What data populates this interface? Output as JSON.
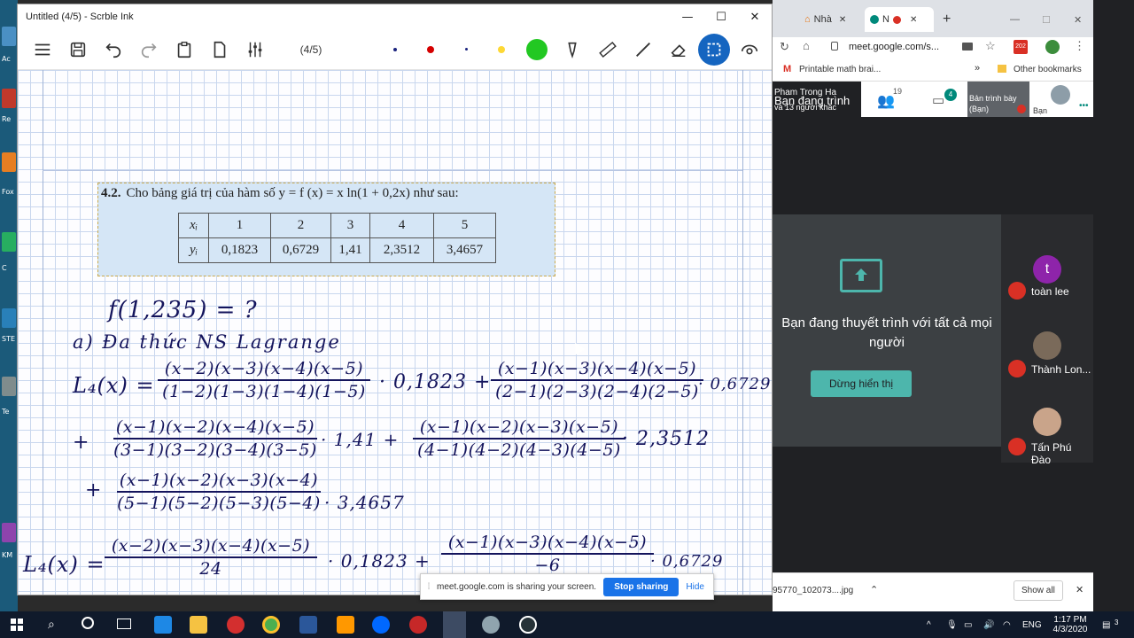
{
  "scrble": {
    "title": "Untitled (4/5) - Scrble Ink",
    "page_indicator": "(4/5)",
    "minimize_glyph": "—",
    "maximize_glyph": "☐",
    "close_glyph": "✕",
    "toolbar_icons": [
      "menu-icon",
      "save-icon",
      "undo-icon",
      "redo-icon",
      "paste-icon",
      "page-icon",
      "sliders-icon"
    ],
    "pen_colors": [
      "#1a237e",
      "#d50000",
      "#1a237e",
      "#fdd835",
      "#22c822"
    ]
  },
  "problem": {
    "number": "4.2.",
    "statement": "Cho bảng giá trị của hàm số  y = f (x) = x ln(1 + 0,2x)  như sau:",
    "row_x_label": "xᵢ",
    "row_y_label": "yᵢ",
    "x_values": [
      "1",
      "2",
      "3",
      "4",
      "5"
    ],
    "y_values": [
      "0,1823",
      "0,6729",
      "1,41",
      "2,3512",
      "3,4657"
    ]
  },
  "handwriting": {
    "question": "f(1,235) = ?",
    "part_a": "a)  Đa  thức  NS  Lagrange",
    "l4_label": "L₄(x) =",
    "t1_num": "(x−2)(x−3)(x−4)(x−5)",
    "t1_den": "(1−2)(1−3)(1−4)(1−5)",
    "t1_coef": "· 0,1823  +",
    "t2_num": "(x−1)(x−3)(x−4)(x−5)",
    "t2_den": "(2−1)(2−3)(2−4)(2−5)",
    "t2_coef": "· 0,6729",
    "plus": "+",
    "t3_num": "(x−1)(x−2)(x−4)(x−5)",
    "t3_den": "(3−1)(3−2)(3−4)(3−5)",
    "t3_coef": "· 1,41  +",
    "t4_num": "(x−1)(x−2)(x−3)(x−5)",
    "t4_den": "(4−1)(4−2)(4−3)(4−5)",
    "t4_coef": "· 2,3512",
    "t5_num": "(x−1)(x−2)(x−3)(x−4)",
    "t5_den": "(5−1)(5−2)(5−3)(5−4)",
    "t5_coef": "· 3,4657",
    "l4_label2": "L₄(x) =",
    "r1_num": "(x−2)(x−3)(x−4)(x−5)",
    "r1_den": "24",
    "r1_coef": "· 0,1823  +",
    "r2_num": "(x−1)(x−3)(x−4)(x−5)",
    "r2_den": "−6",
    "r2_coef": "· 0,6729"
  },
  "chrome": {
    "tab1": "Nhà",
    "tab2": "N",
    "tab_close": "✕",
    "new_tab": "+",
    "url": "meet.google.com/s...",
    "bookmark1": "Printable math brai...",
    "bookmark_more": "»",
    "bookmark2": "Other bookmarks",
    "ext_badge": "202",
    "meet": {
      "presenter_name": "Pham Trong Ha",
      "presenter_sub": "Bạn đang trình",
      "others": "và 13 người khác",
      "people_count": "19",
      "chat_count": "4",
      "present_tile": "Bản trình bày",
      "present_tile_sub": "(Bạn)",
      "you_label": "Bạn",
      "presenting_msg": "Bạn đang thuyết trình với tất cả mọi người",
      "stop_btn": "Dừng hiển thị",
      "participants": [
        {
          "name": "toàn lee",
          "avatar": "t",
          "color": "#8e24aa"
        },
        {
          "name": "Thành Lon...",
          "avatar": "",
          "color": "#7a6a5a"
        },
        {
          "name": "Tấn Phú Đào",
          "avatar": "",
          "color": "#c9a48a"
        }
      ]
    },
    "download_file": "95770_102073....jpg",
    "show_all": "Show all",
    "download_close": "✕"
  },
  "sharebar": {
    "message": "meet.google.com is sharing your screen.",
    "stop": "Stop sharing",
    "hide": "Hide"
  },
  "taskbar": {
    "lang": "ENG",
    "time": "1:17 PM",
    "date": "4/3/2020",
    "notif_count": "3",
    "tray_chevron": "^"
  },
  "desktop": {
    "labels": [
      "Ac",
      "Re",
      "Fox",
      "C",
      "STE",
      "Te",
      "KM"
    ]
  }
}
